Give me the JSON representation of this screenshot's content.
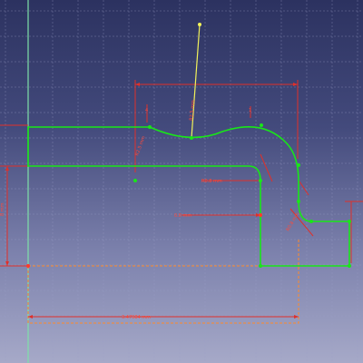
{
  "view": {
    "type": "sketch-editor-3d-view"
  },
  "dimensions": {
    "radius_label": "R2.5 mm",
    "width_label": "3.47984 mm",
    "offset_label": "0.8 mm",
    "small_label": "R0.8 mm",
    "arc_label": "R2.5 mm",
    "corner_label": "R0.8 mm",
    "left_height_label": "8 mm",
    "marker_a": "4",
    "marker_b": "1"
  },
  "colors": {
    "background_top": "#2c3260",
    "background_bottom": "#a6a9c8",
    "geometry": "#19e619",
    "dimension": "#e0302a",
    "construction": "#ff8a2a",
    "axis": "#7ee2a8",
    "handle": "#f2f25a"
  }
}
